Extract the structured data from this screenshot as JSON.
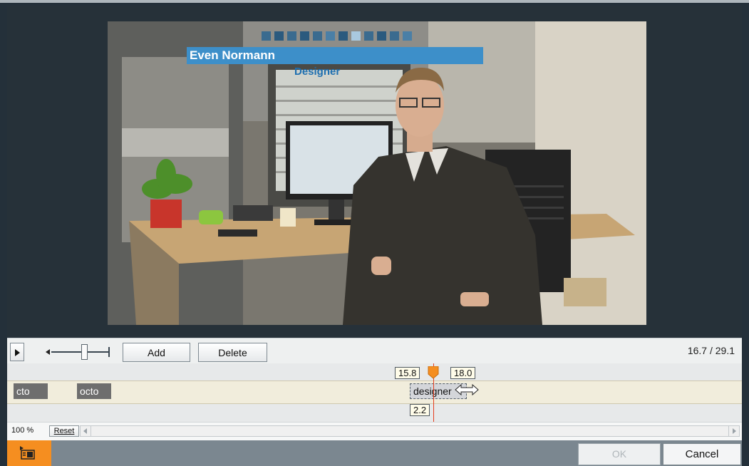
{
  "video": {
    "lower_third": {
      "name": "Even Normann",
      "title": "Designer",
      "accent_color": "#3d8fc9"
    }
  },
  "controls": {
    "play_icon": "play-icon",
    "add_label": "Add",
    "delete_label": "Delete",
    "time_readout": "16.7 / 29.1"
  },
  "timeline": {
    "clips": [
      {
        "label": "cto"
      },
      {
        "label": "octo"
      },
      {
        "label": "designer"
      }
    ],
    "selected_in": "15.8",
    "selected_out": "18.0",
    "selected_duration": "2.2",
    "playhead_color": "#e53d1d"
  },
  "zoom": {
    "level": "100 %",
    "reset_label": "Reset"
  },
  "footer": {
    "toggle_icon": "panel-toggle-icon",
    "ok_label": "OK",
    "cancel_label": "Cancel",
    "accent_color": "#f58e20"
  }
}
